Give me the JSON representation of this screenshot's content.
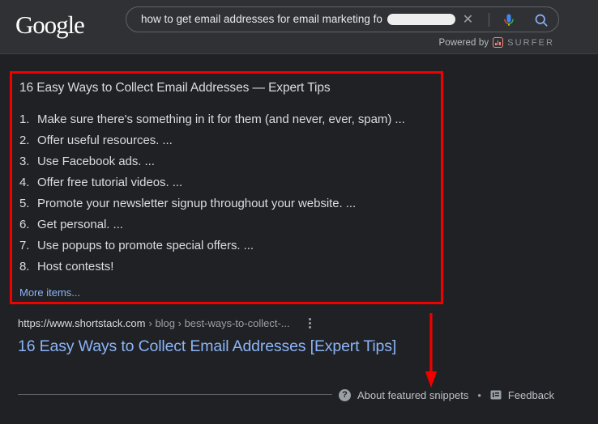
{
  "header": {
    "logo_text": "Google",
    "search": {
      "value": "how to get email addresses for email marketing fo",
      "placeholder": "Search Google or type a URL",
      "clear_label": "✕",
      "redacted": true
    },
    "powered_by": {
      "label": "Powered by",
      "brand": "SURFER",
      "brand_color": "#f08a7e"
    }
  },
  "snippet": {
    "title": "16 Easy Ways to Collect Email Addresses — Expert Tips",
    "items": [
      {
        "num": "1.",
        "text": "Make sure there's something in it for them (and never, ever, spam) ..."
      },
      {
        "num": "2.",
        "text": "Offer useful resources. ..."
      },
      {
        "num": "3.",
        "text": "Use Facebook ads. ..."
      },
      {
        "num": "4.",
        "text": "Offer free tutorial videos. ..."
      },
      {
        "num": "5.",
        "text": "Promote your newsletter signup throughout your website. ..."
      },
      {
        "num": "6.",
        "text": "Get personal. ..."
      },
      {
        "num": "7.",
        "text": "Use popups to promote special offers. ..."
      },
      {
        "num": "8.",
        "text": "Host contests!"
      }
    ],
    "more_items": "More items...",
    "highlight_color": "#f10000"
  },
  "result": {
    "domain": "https://www.shortstack.com",
    "path": "› blog › best-ways-to-collect-...",
    "title": "16 Easy Ways to Collect Email Addresses [Expert Tips]",
    "menu_icon": "three-dots-vertical-icon"
  },
  "annotation": {
    "arrow_color": "#f10000",
    "arrow_direction": "down",
    "points_to": "About featured snippets"
  },
  "footer": {
    "about_label": "About featured snippets",
    "help_glyph": "?",
    "separator": "•",
    "feedback_label": "Feedback"
  },
  "theme": {
    "page_background": "#202124",
    "header_background": "#303134",
    "link_color": "#8ab4f8",
    "text_color": "#dadce0",
    "muted_text_color": "#9aa0a6"
  }
}
